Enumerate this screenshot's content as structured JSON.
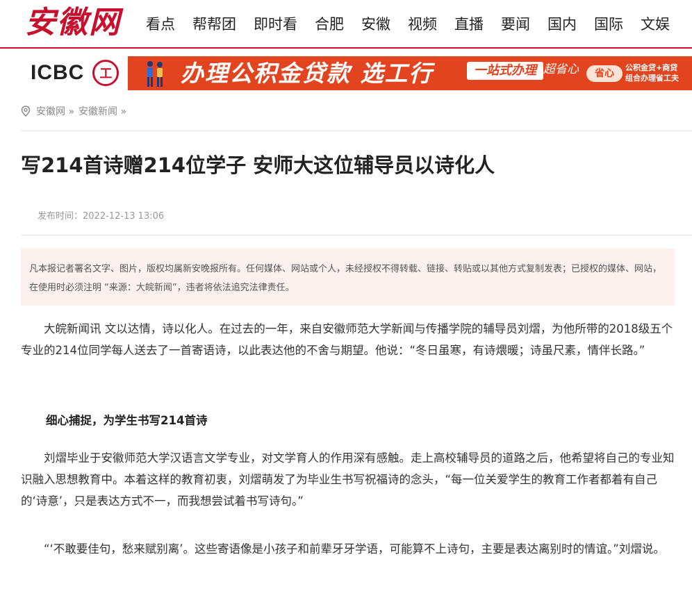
{
  "header": {
    "logo_text": "安徽网",
    "nav": [
      "看点",
      "帮帮团",
      "即时看",
      "合肥",
      "安徽",
      "视频",
      "直播",
      "要闻",
      "国内",
      "国际",
      "文娱"
    ]
  },
  "banner": {
    "bank_logo": "ICBC",
    "bank_badge": "工",
    "ad_main": "办理公积金贷款 选工行",
    "ad_box": "一站式办理",
    "ad_tag": "超省心",
    "ad_pill": "省心",
    "ad_small_1": "公积金贷+商贷",
    "ad_small_2": "组合办理省工夫",
    "accent": "#e2441f"
  },
  "breadcrumb": {
    "icon": "location-pin-icon",
    "items": [
      "安徽网 »",
      "安徽新闻 »"
    ]
  },
  "article": {
    "title": "写214首诗赠214位学子 安师大这位辅导员以诗化人",
    "publish_time": "发布时间：2022-12-13 13:06",
    "notice": "凡本报记者署名文字、图片，版权均属新安晚报所有。任何媒体、网站或个人，未经授权不得转载、链接、转贴或以其他方式复制发表；已授权的媒体、网站，在使用时必须注明 “来源：大皖新闻”，违者将依法追究法律责任。",
    "p1": "大皖新闻讯 文以达情，诗以化人。在过去的一年，来自安徽师范大学新闻与传播学院的辅导员刘熠，为他所带的2018级五个专业的214位同学每人送去了一首寄语诗，以此表达他的不舍与期望。他说：“冬日虽寒，有诗煨暖；诗虽尺素，情伴长路。”",
    "subheading": "细心捕捉，为学生书写214首诗",
    "p2": "刘熠毕业于安徽师范大学汉语言文学专业，对文学育人的作用深有感触。走上高校辅导员的道路之后，他希望将自己的专业知识融入思想教育中。本着这样的教育初衷，刘熠萌发了为毕业生书写祝福诗的念头，“每一位关爱学生的教育工作者都着有自己的‘诗意’，只是表达方式不一，而我想尝试着书写诗句。”",
    "p3": "“‘不敢要佳句，愁来赋别离’。这些寄语像是小孩子和前辈牙牙学语，可能算不上诗句，主要是表达离别时的情谊。”刘熠说。"
  },
  "colors": {
    "brand": "#c8102e",
    "notice_bg": "#fdf1ef"
  }
}
